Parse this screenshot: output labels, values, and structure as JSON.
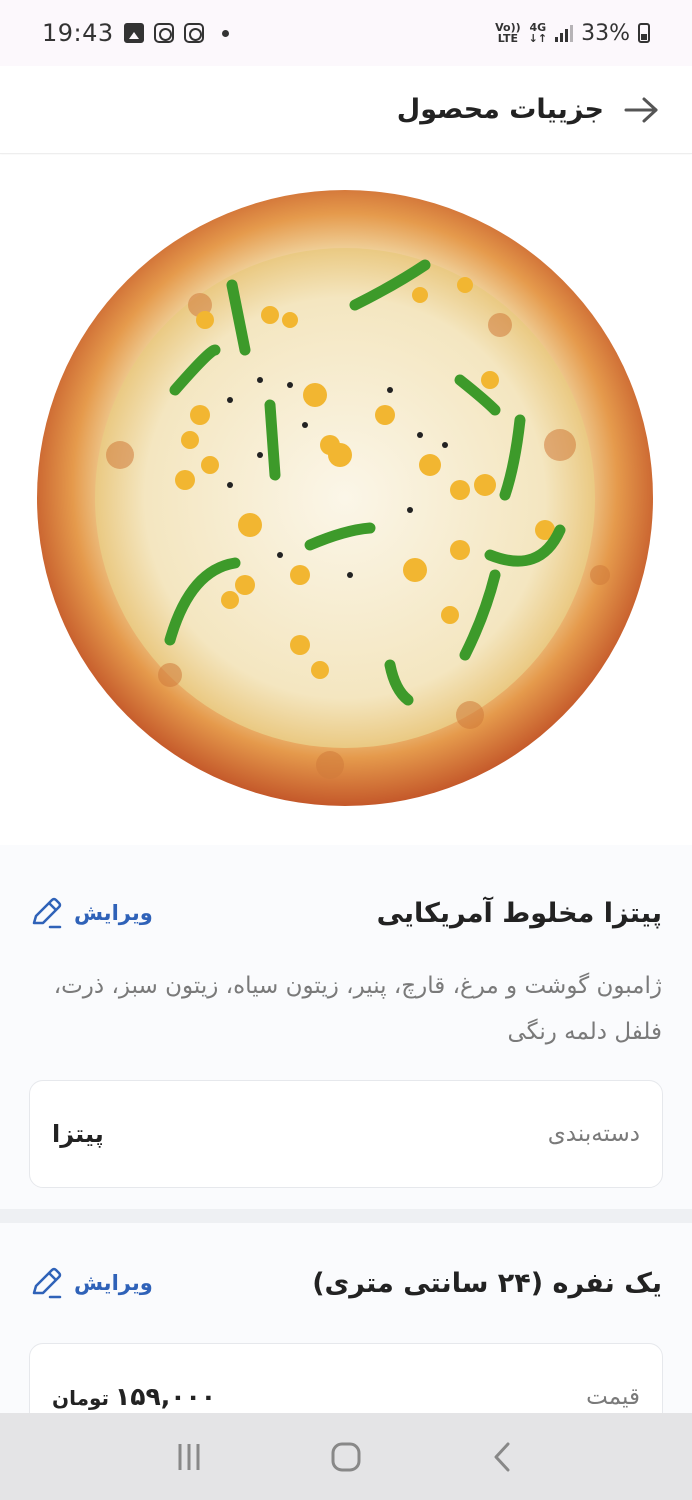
{
  "status_bar": {
    "time": "19:43",
    "network_top": "Vo))",
    "network_bottom": "LTE",
    "gen": "4G",
    "battery": "33%"
  },
  "header": {
    "title": "جزییات محصول",
    "back_icon": "arrow-right-icon"
  },
  "product": {
    "image_alt": "pizza-image",
    "title": "پیتزا مخلوط آمریکایی",
    "edit_label": "ویرایش",
    "description": "ژامبون گوشت و مرغ، قارچ، پنیر، زیتون سیاه، زیتون سبز، ذرت، فلفل دلمه رنگی",
    "category_label": "دسته‌بندی",
    "category_value": "پیتزا"
  },
  "variant": {
    "title": "یک نفره (۲۴ سانتی متری)",
    "edit_label": "ویرایش",
    "price_label": "قیمت",
    "price_value": "۱۵۹,۰۰۰",
    "price_unit": "تومان"
  },
  "colors": {
    "accent": "#2f62b8",
    "text": "#222222",
    "muted": "#7a7a7a"
  }
}
